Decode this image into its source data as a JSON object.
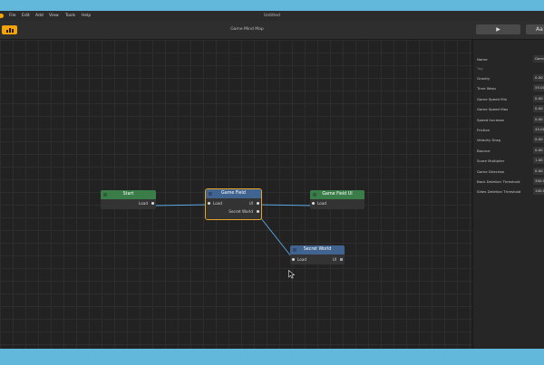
{
  "app": {
    "window_title": "Untitled",
    "menu": [
      "File",
      "Edit",
      "Add",
      "View",
      "Tools",
      "Help"
    ]
  },
  "toolbar": {
    "title": "Game Mind Map",
    "play_glyph": "▶",
    "text_button": "Aa"
  },
  "nodes": {
    "start": {
      "title": "Start",
      "out_label": "Load"
    },
    "game_field": {
      "title": "Game Field",
      "in_label": "Load",
      "out_ui_label": "UI",
      "out_secret_label": "Secret World"
    },
    "game_field_ui": {
      "title": "Game Field UI",
      "in_label": "Load"
    },
    "secret_world": {
      "title": "Secret World",
      "in_label": "Load",
      "out_ui_label": "UI"
    }
  },
  "properties": {
    "name": {
      "label": "Name",
      "value": "Game F"
    },
    "tag": {
      "label": "Tag",
      "value": "Tag"
    },
    "rows": [
      {
        "label": "Gravity",
        "value": "0.00"
      },
      {
        "label": "Time Warp",
        "value": "55.00"
      },
      {
        "label": "Game Speed Min",
        "value": "0.00"
      },
      {
        "label": "Game Speed Max",
        "value": "0.00"
      },
      {
        "label": "Speed Increase",
        "value": "0.00"
      },
      {
        "label": "Friction",
        "value": "45.00"
      },
      {
        "label": "Velocity Drag",
        "value": "0.00"
      },
      {
        "label": "Bounce",
        "value": "0.00"
      },
      {
        "label": "Score Multiplier",
        "value": "1.00"
      },
      {
        "label": "Game Direction",
        "value": "0.00"
      },
      {
        "label": "Back Deletion Threshold",
        "value": "300.00"
      },
      {
        "label": "Sides Deletion Threshold",
        "value": "100.00"
      }
    ]
  },
  "colors": {
    "accent": "#f2a30a",
    "wire": "#5aa9e6",
    "node_green": "#3b7d48",
    "node_blue": "#40648f",
    "selected_outline": "#e8a32a"
  }
}
